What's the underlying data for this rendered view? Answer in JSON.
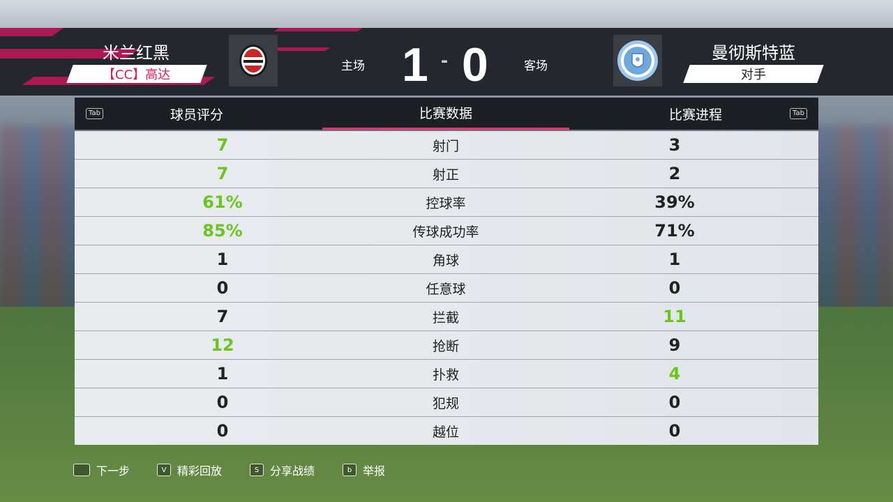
{
  "header": {
    "home_team": "米兰红黑",
    "home_manager": "【CC】高达",
    "away_team": "曼彻斯特蓝",
    "away_manager": "对手",
    "home_label": "主场",
    "away_label": "客场",
    "score_home": "1",
    "score_sep": "-",
    "score_away": "0"
  },
  "tabs": {
    "left_key": "Tab",
    "right_key": "Tab",
    "items": [
      "球员评分",
      "比赛数据",
      "比赛进程"
    ],
    "active": "比赛数据"
  },
  "stats": [
    {
      "label": "射门",
      "home": "7",
      "away": "3",
      "highlight": "home"
    },
    {
      "label": "射正",
      "home": "7",
      "away": "2",
      "highlight": "home"
    },
    {
      "label": "控球率",
      "home": "61%",
      "away": "39%",
      "highlight": "home"
    },
    {
      "label": "传球成功率",
      "home": "85%",
      "away": "71%",
      "highlight": "home"
    },
    {
      "label": "角球",
      "home": "1",
      "away": "1",
      "highlight": "none"
    },
    {
      "label": "任意球",
      "home": "0",
      "away": "0",
      "highlight": "none"
    },
    {
      "label": "拦截",
      "home": "7",
      "away": "11",
      "highlight": "away"
    },
    {
      "label": "抢断",
      "home": "12",
      "away": "9",
      "highlight": "home"
    },
    {
      "label": "扑救",
      "home": "1",
      "away": "4",
      "highlight": "away"
    },
    {
      "label": "犯规",
      "home": "0",
      "away": "0",
      "highlight": "none"
    },
    {
      "label": "越位",
      "home": "0",
      "away": "0",
      "highlight": "none"
    }
  ],
  "footer": {
    "next": {
      "key": "",
      "label": "下一步"
    },
    "highlights": {
      "key": "V",
      "label": "精彩回放"
    },
    "share": {
      "key": "S",
      "label": "分享战绩"
    },
    "report": {
      "key": "b",
      "label": "举报"
    }
  },
  "colors": {
    "highlight_green": "#6cc51f",
    "accent_pink": "#c2185b",
    "home_manager_text": "#d81b60",
    "header_bg": "#24272d"
  },
  "badges": {
    "home": "milan-red-black-crest-icon",
    "away": "manchester-blue-crest-icon"
  }
}
